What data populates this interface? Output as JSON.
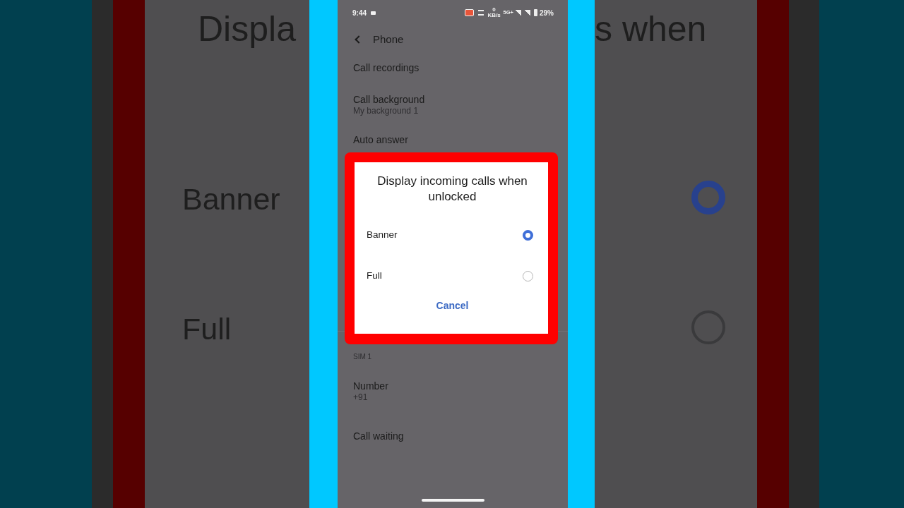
{
  "backdrop": {
    "title_left": "Displa",
    "title_right": "s when",
    "options": [
      {
        "label": "Banner",
        "selected": true
      },
      {
        "label": "Full",
        "selected": false
      }
    ]
  },
  "status_bar": {
    "time": "9:44",
    "net_speed": "0 KB/s",
    "network": "5G+",
    "battery": "29%"
  },
  "header": {
    "title": "Phone"
  },
  "settings": [
    {
      "kind": "item",
      "title": "Call recordings"
    },
    {
      "kind": "item",
      "title": "Call background",
      "subtitle": "My background 1"
    },
    {
      "kind": "item",
      "title": "Auto answer"
    },
    {
      "kind": "section",
      "title": "SIM 1"
    },
    {
      "kind": "item",
      "title": "Number",
      "subtitle": "+91"
    },
    {
      "kind": "item",
      "title": "Call waiting"
    }
  ],
  "dialog": {
    "title": "Display incoming calls when unlocked",
    "options": [
      {
        "label": "Banner",
        "selected": true
      },
      {
        "label": "Full",
        "selected": false
      }
    ],
    "cancel": "Cancel"
  }
}
